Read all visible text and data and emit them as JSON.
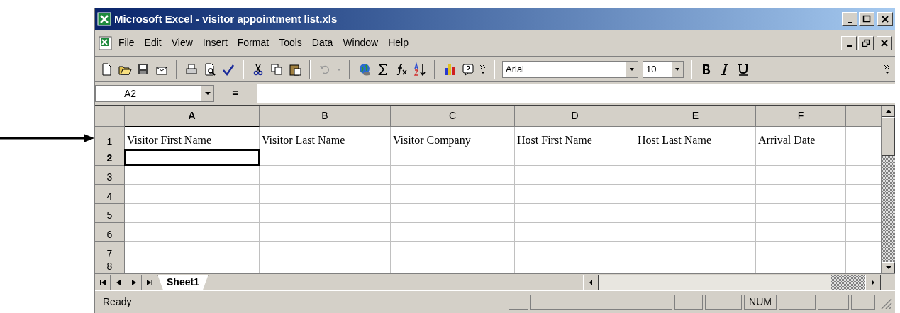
{
  "window": {
    "title": "Microsoft Excel - visitor appointment list.xls"
  },
  "menu": [
    "File",
    "Edit",
    "View",
    "Insert",
    "Format",
    "Tools",
    "Data",
    "Window",
    "Help"
  ],
  "toolbar": {
    "font": "Arial",
    "size": "10"
  },
  "formula_bar": {
    "name_box": "A2",
    "equals": "="
  },
  "sheet": {
    "columns": [
      {
        "label": "A",
        "selected": true
      },
      {
        "label": "B",
        "selected": false
      },
      {
        "label": "C",
        "selected": false
      },
      {
        "label": "D",
        "selected": false
      },
      {
        "label": "E",
        "selected": false
      },
      {
        "label": "F",
        "selected": false
      }
    ],
    "rows": [
      {
        "label": "1",
        "selected": false,
        "cells": [
          "Visitor First Name",
          "Visitor Last Name",
          "Visitor Company",
          "Host First Name",
          "Host Last Name",
          "Arrival Date"
        ]
      },
      {
        "label": "2",
        "selected": true,
        "cells": []
      },
      {
        "label": "3",
        "selected": false,
        "cells": []
      },
      {
        "label": "4",
        "selected": false,
        "cells": []
      },
      {
        "label": "5",
        "selected": false,
        "cells": []
      },
      {
        "label": "6",
        "selected": false,
        "cells": []
      },
      {
        "label": "7",
        "selected": false,
        "cells": []
      },
      {
        "label": "8",
        "selected": false,
        "cells": []
      }
    ],
    "active_cell_selected": true
  },
  "sheet_tabs": [
    {
      "label": "Sheet1",
      "selected": true
    }
  ],
  "status_bar": {
    "status": "Ready",
    "indicator": "NUM"
  }
}
